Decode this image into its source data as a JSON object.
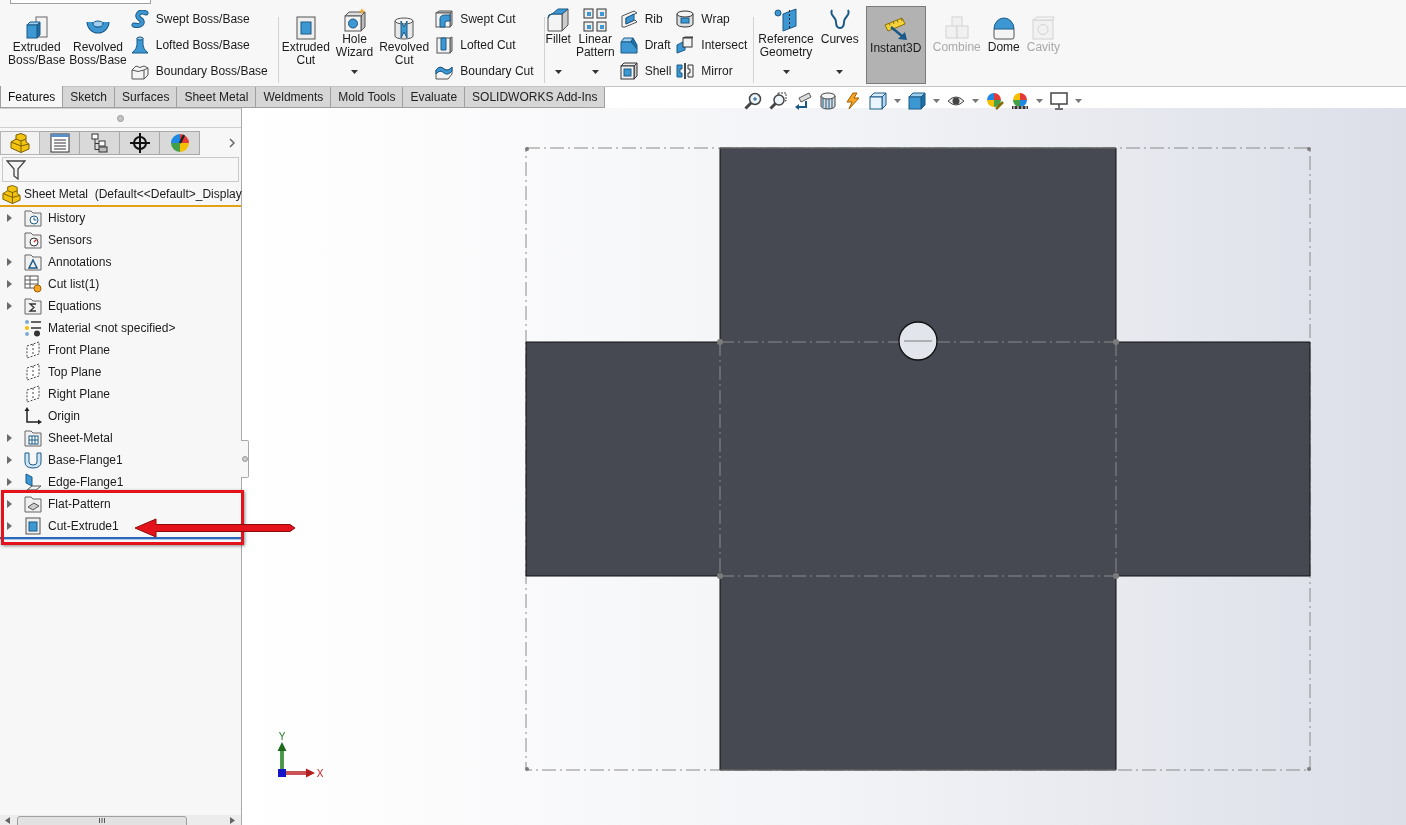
{
  "ribbon": {
    "groups": [
      {
        "items": [
          {
            "kind": "large",
            "label": "Extruded Boss/Base",
            "dropdown": false
          },
          {
            "kind": "large",
            "label": "Revolved Boss/Base",
            "dropdown": false
          },
          {
            "kind": "stack",
            "items": [
              {
                "label": "Swept Boss/Base"
              },
              {
                "label": "Lofted Boss/Base"
              },
              {
                "label": "Boundary Boss/Base"
              }
            ]
          }
        ]
      },
      {
        "items": [
          {
            "kind": "large",
            "label": "Extruded Cut",
            "dropdown": false
          },
          {
            "kind": "large",
            "label": "Hole Wizard",
            "dropdown": true
          },
          {
            "kind": "large",
            "label": "Revolved Cut",
            "dropdown": false
          },
          {
            "kind": "stack",
            "items": [
              {
                "label": "Swept Cut"
              },
              {
                "label": "Lofted Cut"
              },
              {
                "label": "Boundary Cut"
              }
            ]
          }
        ]
      },
      {
        "items": [
          {
            "kind": "large",
            "label": "Fillet",
            "dropdown": true
          },
          {
            "kind": "large",
            "label": "Linear Pattern",
            "dropdown": true
          },
          {
            "kind": "stack",
            "items": [
              {
                "label": "Rib"
              },
              {
                "label": "Draft"
              },
              {
                "label": "Shell"
              }
            ]
          },
          {
            "kind": "stack",
            "items": [
              {
                "label": "Wrap"
              },
              {
                "label": "Intersect"
              },
              {
                "label": "Mirror"
              }
            ]
          }
        ]
      },
      {
        "items": [
          {
            "kind": "large",
            "label": "Reference Geometry",
            "dropdown": true,
            "on": false,
            "disabled": false
          },
          {
            "kind": "large",
            "label": "Curves",
            "dropdown": true,
            "on": false,
            "disabled": false
          },
          {
            "kind": "large",
            "label": "Instant3D",
            "dropdown": false,
            "on": true,
            "disabled": false
          },
          {
            "kind": "large",
            "label": "Combine",
            "dropdown": false,
            "on": false,
            "disabled": true
          },
          {
            "kind": "large",
            "label": "Dome",
            "dropdown": false,
            "on": false,
            "disabled": false
          },
          {
            "kind": "large",
            "label": "Cavity",
            "dropdown": false,
            "on": false,
            "disabled": true
          }
        ]
      }
    ]
  },
  "tabs": [
    {
      "label": "Features",
      "selected": true
    },
    {
      "label": "Sketch",
      "selected": false
    },
    {
      "label": "Surfaces",
      "selected": false
    },
    {
      "label": "Sheet Metal",
      "selected": false
    },
    {
      "label": "Weldments",
      "selected": false
    },
    {
      "label": "Mold Tools",
      "selected": false
    },
    {
      "label": "Evaluate",
      "selected": false
    },
    {
      "label": "SOLIDWORKS Add-Ins",
      "selected": false
    }
  ],
  "feature_manager": {
    "panel_tabs": [
      {
        "selected": true
      },
      {
        "selected": false
      },
      {
        "selected": false
      },
      {
        "selected": false
      },
      {
        "selected": false
      }
    ],
    "root_label": "Sheet Metal  (Default<<Default>_Display",
    "tree": [
      {
        "label": "History",
        "expandable": true,
        "highlighted": false
      },
      {
        "label": "Sensors",
        "expandable": false,
        "highlighted": false
      },
      {
        "label": "Annotations",
        "expandable": true,
        "highlighted": false
      },
      {
        "label": "Cut list(1)",
        "expandable": true,
        "highlighted": false
      },
      {
        "label": "Equations",
        "expandable": true,
        "highlighted": false
      },
      {
        "label": "Material <not specified>",
        "expandable": false,
        "highlighted": false
      },
      {
        "label": "Front Plane",
        "expandable": false,
        "highlighted": false
      },
      {
        "label": "Top Plane",
        "expandable": false,
        "highlighted": false
      },
      {
        "label": "Right Plane",
        "expandable": false,
        "highlighted": false
      },
      {
        "label": "Origin",
        "expandable": false,
        "highlighted": false
      },
      {
        "label": "Sheet-Metal",
        "expandable": true,
        "highlighted": false
      },
      {
        "label": "Base-Flange1",
        "expandable": true,
        "highlighted": false
      },
      {
        "label": "Edge-Flange1",
        "expandable": true,
        "highlighted": false
      },
      {
        "label": "Flat-Pattern",
        "expandable": true,
        "highlighted": true
      },
      {
        "label": "Cut-Extrude1",
        "expandable": true,
        "highlighted": true
      }
    ]
  },
  "triad": {
    "x_label": "X",
    "y_label": "Y"
  }
}
